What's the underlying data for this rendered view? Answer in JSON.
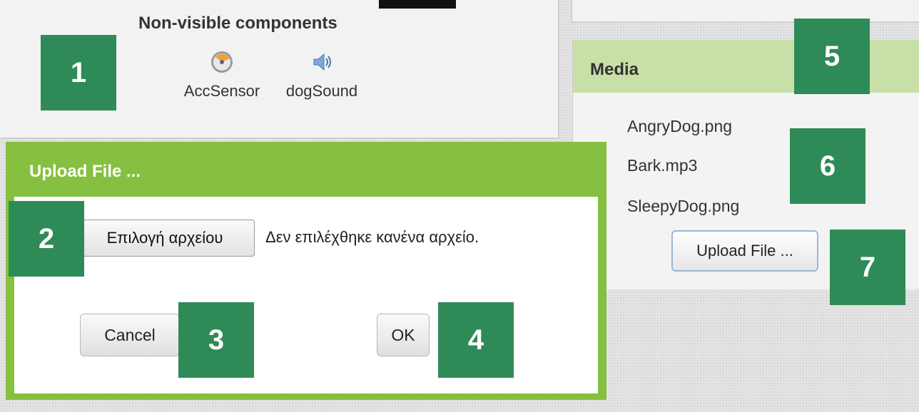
{
  "nonvisible": {
    "title": "Non-visible components",
    "components": [
      {
        "label": "AccSensor",
        "icon": "accelerometer-sensor-icon"
      },
      {
        "label": "dogSound",
        "icon": "speaker-sound-icon"
      }
    ]
  },
  "media": {
    "title": "Media",
    "files": [
      "AngryDog.png",
      "Bark.mp3",
      "SleepyDog.png"
    ],
    "upload_label": "Upload File ..."
  },
  "dialog": {
    "title": "Upload File ...",
    "choose_label": "Επιλογή αρχείου",
    "no_file_text": "Δεν επιλέχθηκε κανένα αρχείο.",
    "cancel_label": "Cancel",
    "ok_label": "OK"
  },
  "badges": [
    "1",
    "2",
    "3",
    "4",
    "5",
    "6",
    "7"
  ],
  "colors": {
    "dialog_green": "#86c040",
    "badge_green": "#2e8b57",
    "media_header": "#c8dfa8"
  }
}
